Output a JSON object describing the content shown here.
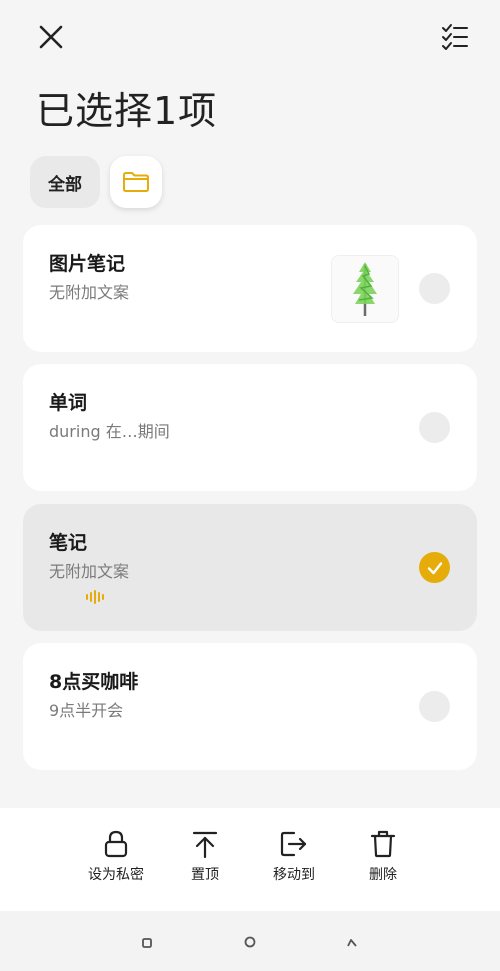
{
  "header": {
    "title": "已选择1项",
    "close_icon": "close-icon",
    "select_all_icon": "checklist-icon"
  },
  "filters": {
    "all_label": "全部",
    "folder_icon": "folder-icon",
    "accent": "#e6ac0a"
  },
  "notes": [
    {
      "title": "图片笔记",
      "subtitle": "无附加文案",
      "has_image": true,
      "selected": false
    },
    {
      "title": "单词",
      "subtitle": "during 在…期间",
      "has_image": false,
      "selected": false
    },
    {
      "title": "笔记",
      "subtitle": "无附加文案",
      "has_audio": true,
      "selected": true
    },
    {
      "title": "8点买咖啡",
      "subtitle": "9点半开会",
      "has_image": false,
      "selected": false
    }
  ],
  "actions": [
    {
      "label": "设为私密",
      "icon": "lock-icon"
    },
    {
      "label": "置顶",
      "icon": "pin-top-icon"
    },
    {
      "label": "移动到",
      "icon": "move-to-icon"
    },
    {
      "label": "删除",
      "icon": "trash-icon"
    }
  ],
  "system_nav": {
    "recents_icon": "square-icon",
    "home_icon": "circle-icon",
    "back_icon": "back-triangle-icon"
  }
}
